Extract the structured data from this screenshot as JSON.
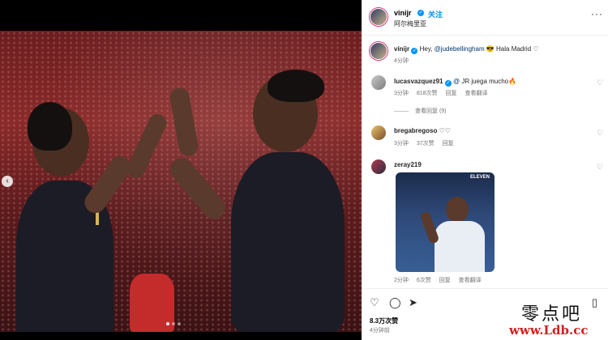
{
  "post": {
    "username": "vinijr",
    "follow_label": "关注",
    "location": "阿尔梅里亚",
    "more": "···"
  },
  "caption": {
    "username": "vinijr",
    "text_before": "Hey, ",
    "mention": "@judebellingham",
    "text_after": " 😎 Hala Madrid ♡",
    "time": "4分钟"
  },
  "comments": [
    {
      "username": "lucasvazquez91",
      "mention": "@",
      "text": "JR juega mucho🔥",
      "time": "3分钟",
      "likes": "818次赞",
      "reply": "回复",
      "translate": "查看翻译",
      "view_replies": "查看回复 (9)"
    },
    {
      "username": "bregabregoso",
      "text": "♡♡",
      "time": "3分钟",
      "likes": "37次赞",
      "reply": "回复"
    },
    {
      "username": "zeray219",
      "gif_label": "ELEVEN",
      "time": "2分钟",
      "likes": "6次赞",
      "reply": "回复",
      "translate": "查看翻译"
    }
  ],
  "actions": {
    "like_icon": "heart-icon",
    "comment_icon": "comment-icon",
    "share_icon": "share-icon",
    "save_icon": "bookmark-icon",
    "likes": "8.3万次赞",
    "time": "4分钟前"
  },
  "watermark": {
    "name": "零点吧",
    "url": "www.Ldb.cc"
  },
  "colors": {
    "link": "#0095f6",
    "mention": "#00376b",
    "muted": "#737373",
    "watermark_red": "#d01f1f"
  }
}
